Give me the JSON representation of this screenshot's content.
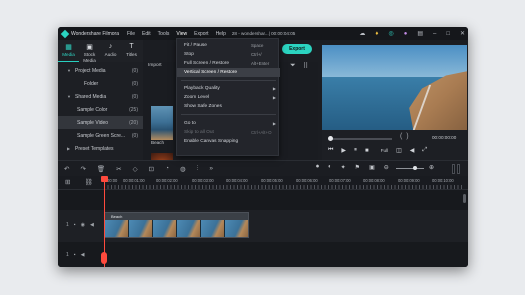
{
  "window": {
    "app_name": "Wondershare Filmora",
    "project_title": "28 - wondershar...| 00:00:04:05",
    "menu": [
      "File",
      "Edit",
      "Tools",
      "View",
      "Export",
      "Help"
    ]
  },
  "title_icons": [
    "cloud-icon",
    "bulb-icon",
    "headset-icon",
    "avatar",
    "layout-icon",
    "minimize-icon",
    "maximize-icon",
    "close-icon"
  ],
  "left_tabs": [
    {
      "label": "Media",
      "icon": "▦"
    },
    {
      "label": "Stock Media",
      "icon": "▣"
    },
    {
      "label": "Audio",
      "icon": "♪"
    },
    {
      "label": "Titles",
      "icon": "T"
    }
  ],
  "sidebar": {
    "items": [
      {
        "label": "Project Media",
        "count": "(0)"
      },
      {
        "label": "Folder",
        "count": "(0)"
      },
      {
        "label": "Shared Media",
        "count": "(0)"
      },
      {
        "label": "Sample Color",
        "count": "(25)"
      },
      {
        "label": "Sample Video",
        "count": "(20)"
      },
      {
        "label": "Sample Green Scre...",
        "count": "(0)"
      },
      {
        "label": "Preset Templates",
        "count": ""
      }
    ]
  },
  "media": {
    "import_label": "Import",
    "thumb1_label": "Beach"
  },
  "view_menu": {
    "items": [
      {
        "label": "Fit / Pause",
        "shortcut": "Space"
      },
      {
        "label": "Stop",
        "shortcut": "Ctrl+/"
      },
      {
        "label": "Full Screen / Restore",
        "shortcut": "Alt+Enter"
      },
      {
        "label": "Vertical Screen / Restore",
        "shortcut": ""
      },
      {
        "label": "Playback Quality",
        "shortcut": ""
      },
      {
        "label": "Zoom Level",
        "shortcut": ""
      },
      {
        "label": "Show Safe Zones",
        "shortcut": ""
      },
      {
        "label": "Go to",
        "shortcut": ""
      },
      {
        "label": "Skip to all Out",
        "shortcut": "Ctrl+Alt+O"
      },
      {
        "label": "Enable Canvas Snapping",
        "shortcut": ""
      }
    ]
  },
  "export_button": "Export",
  "player": {
    "timecode": "00:00:00:00",
    "quality": "Full"
  },
  "ruler": {
    "ticks": [
      "00:00",
      "00:00:01:00",
      "00:00:02:00",
      "00:00:03:00",
      "00:00:04:00",
      "00:00:05:00",
      "00:00:06:00",
      "00:00:07:00",
      "00:00:08:00",
      "00:00:09:00",
      "00:00:10:00"
    ]
  },
  "timeline": {
    "clip_label": "Beach",
    "track1_num": "1",
    "track2_num": "1"
  }
}
